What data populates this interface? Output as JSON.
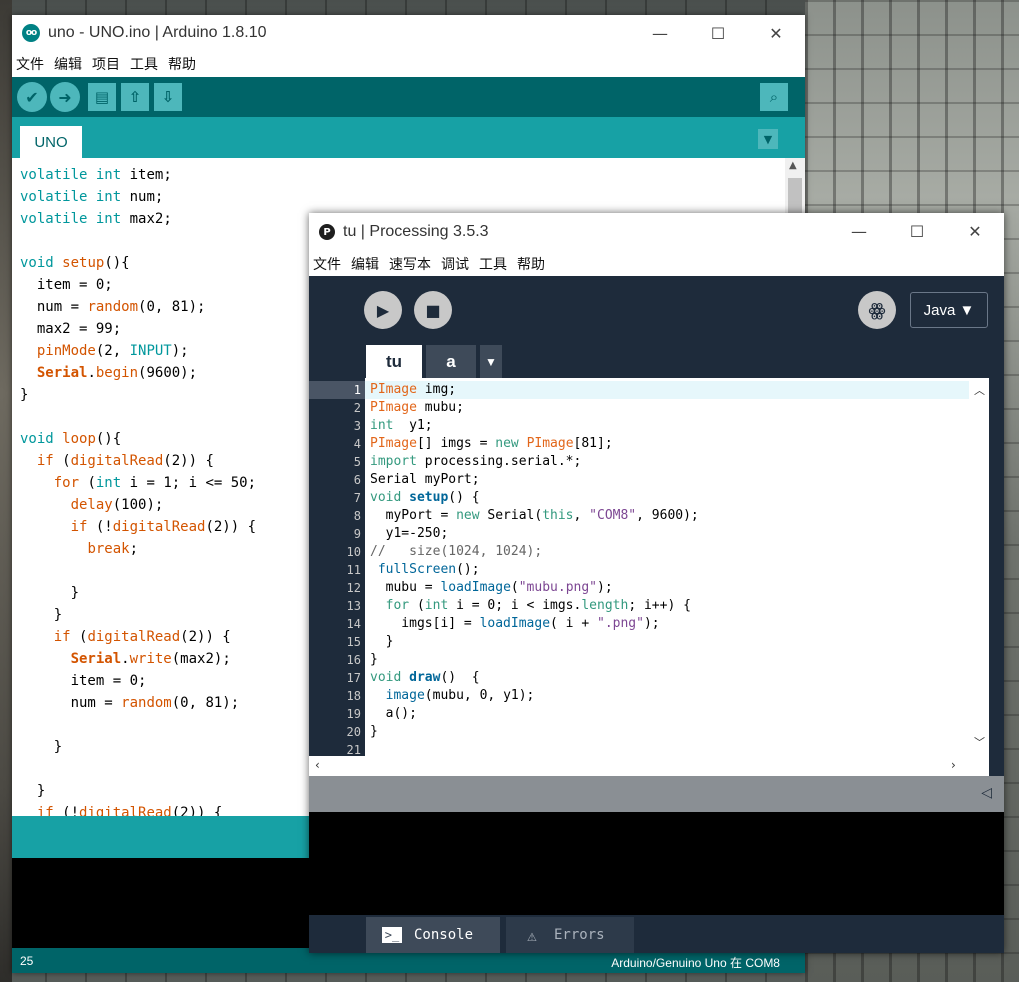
{
  "arduino": {
    "title": "uno - UNO.ino | Arduino 1.8.10",
    "app_icon": "infinity-icon",
    "menu": [
      "文件",
      "编辑",
      "项目",
      "工具",
      "帮助"
    ],
    "toolbar": {
      "verify": "✔",
      "upload": "➜",
      "new": "▤",
      "open": "⇧",
      "save": "⇩",
      "serial_monitor": "⌕"
    },
    "tab": "UNO",
    "tab_menu": "▼",
    "code": [
      "volatile int item;",
      "volatile int num;",
      "volatile int max2;",
      "",
      "void setup(){",
      "  item = 0;",
      "  num = random(0, 81);",
      "  max2 = 99;",
      "  pinMode(2, INPUT);",
      "  Serial.begin(9600);",
      "}",
      "",
      "void loop(){",
      "  if (digitalRead(2)) {",
      "    for (int i = 1; i <= 50;",
      "      delay(100);",
      "      if (!digitalRead(2)) {",
      "        break;",
      "",
      "      }",
      "    }",
      "    if (digitalRead(2)) {",
      "      Serial.write(max2);",
      "      item = 0;",
      "      num = random(0, 81);",
      "",
      "    }",
      "",
      "  }",
      "  if (!digitalRead(2)) {"
    ],
    "line_number": "25",
    "board": "Arduino/Genuino Uno 在 COM8"
  },
  "processing": {
    "title": "tu | Processing 3.5.3",
    "app_icon": "processing-p-icon",
    "menu": [
      "文件",
      "编辑",
      "速写本",
      "调试",
      "工具",
      "帮助"
    ],
    "mode": "Java ▼",
    "tabs": [
      "tu",
      "a"
    ],
    "tab_menu": "▼",
    "line_numbers": [
      "1",
      "2",
      "3",
      "4",
      "5",
      "6",
      "7",
      "8",
      "9",
      "10",
      "11",
      "12",
      "13",
      "14",
      "15",
      "16",
      "17",
      "18",
      "19",
      "20",
      "21"
    ],
    "code": [
      "PImage img;",
      "PImage mubu;",
      "int  y1;",
      "PImage[] imgs = new PImage[81];",
      "import processing.serial.*;",
      "Serial myPort;",
      "void setup() {",
      "  myPort = new Serial(this, \"COM8\", 9600);",
      "  y1=-250;",
      "//   size(1024, 1024);",
      " fullScreen();",
      "  mubu = loadImage(\"mubu.png\");",
      "  for (int i = 0; i < imgs.length; i++) {",
      "    imgs[i] = loadImage( i + \".png\");",
      "  }",
      "}",
      "void draw()  {",
      "  image(mubu, 0, y1);",
      "  a();",
      "}",
      ""
    ],
    "console_tabs": {
      "console": "Console",
      "errors": "Errors"
    }
  },
  "window_controls": {
    "minimize": "—",
    "maximize": "☐",
    "close": "✕"
  },
  "colors": {
    "arduino_teal_dark": "#006468",
    "arduino_teal": "#17a1a5",
    "processing_navy": "#1e2b3b"
  }
}
